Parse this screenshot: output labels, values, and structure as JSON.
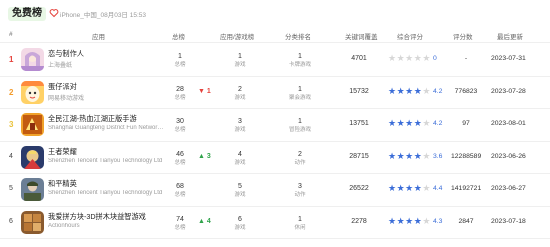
{
  "header": {
    "title": "免费榜",
    "subinfo": "iPhone_中国_08月03日 15:53"
  },
  "columns": {
    "index": "#",
    "app": "应用",
    "total": "总榜",
    "app_game": "应用/游戏榜",
    "category": "分类排名",
    "keyword": "关键词覆盖",
    "rating": "综合评分",
    "reviews": "评分数",
    "updated": "最后更新"
  },
  "rows": [
    {
      "rank": "1",
      "name": "恋与制作人",
      "dev": "上海叠纸",
      "total": "1",
      "total_sub": "总榜",
      "change": "",
      "change_dir": "",
      "appgame": "1",
      "appgame_sub": "游戏",
      "cat": "1",
      "cat_sub": "卡牌游戏",
      "cover": "4701",
      "stars": 0,
      "score": "0",
      "reviews": "-",
      "date": "2023-07-31",
      "icon": "anime-girl-icon"
    },
    {
      "rank": "2",
      "name": "蛋仔派对",
      "dev": "网易移动游戏",
      "total": "28",
      "total_sub": "总榜",
      "change": "1",
      "change_dir": "down",
      "appgame": "2",
      "appgame_sub": "游戏",
      "cat": "1",
      "cat_sub": "聚会游戏",
      "cover": "15732",
      "stars": 4,
      "score": "4.2",
      "reviews": "776823",
      "date": "2023-07-28",
      "icon": "eggy-party-icon"
    },
    {
      "rank": "3",
      "name": "全民江湖-热血江湖正版手游",
      "dev": "Shanghai Guangteng District Fun Network ...",
      "total": "30",
      "total_sub": "总榜",
      "change": "",
      "change_dir": "",
      "appgame": "3",
      "appgame_sub": "游戏",
      "cat": "1",
      "cat_sub": "冒险游戏",
      "cover": "13751",
      "stars": 4,
      "score": "4.2",
      "reviews": "97",
      "date": "2023-08-01",
      "icon": "jianghu-icon"
    },
    {
      "rank": "4",
      "name": "王者荣耀",
      "dev": "Shenzhen Tencent Tianyou Technology Ltd",
      "total": "46",
      "total_sub": "总榜",
      "change": "3",
      "change_dir": "up",
      "appgame": "4",
      "appgame_sub": "游戏",
      "cat": "2",
      "cat_sub": "动作",
      "cover": "28715",
      "stars": 4,
      "score": "3.6",
      "reviews": "12288589",
      "date": "2023-06-26",
      "icon": "honor-of-kings-icon"
    },
    {
      "rank": "5",
      "name": "和平精英",
      "dev": "Shenzhen Tencent Tianyou Technology Ltd",
      "total": "68",
      "total_sub": "总榜",
      "change": "",
      "change_dir": "",
      "appgame": "5",
      "appgame_sub": "游戏",
      "cat": "3",
      "cat_sub": "动作",
      "cover": "26522",
      "stars": 4,
      "score": "4.4",
      "reviews": "14192721",
      "date": "2023-06-27",
      "icon": "peace-elite-icon"
    },
    {
      "rank": "6",
      "name": "我爱拼方块-3D拼木块益智游戏",
      "dev": "Actionhours",
      "total": "74",
      "total_sub": "总榜",
      "change": "4",
      "change_dir": "up",
      "appgame": "6",
      "appgame_sub": "游戏",
      "cat": "1",
      "cat_sub": "休闲",
      "cover": "2278",
      "stars": 4,
      "score": "4.3",
      "reviews": "2847",
      "date": "2023-07-18",
      "icon": "block-puzzle-icon"
    }
  ],
  "colors": {
    "accent_blue": "#3b6dd8",
    "up_green": "#2fa34a",
    "down_red": "#e5423c",
    "title_pill_bg": "#e8f7e5"
  }
}
